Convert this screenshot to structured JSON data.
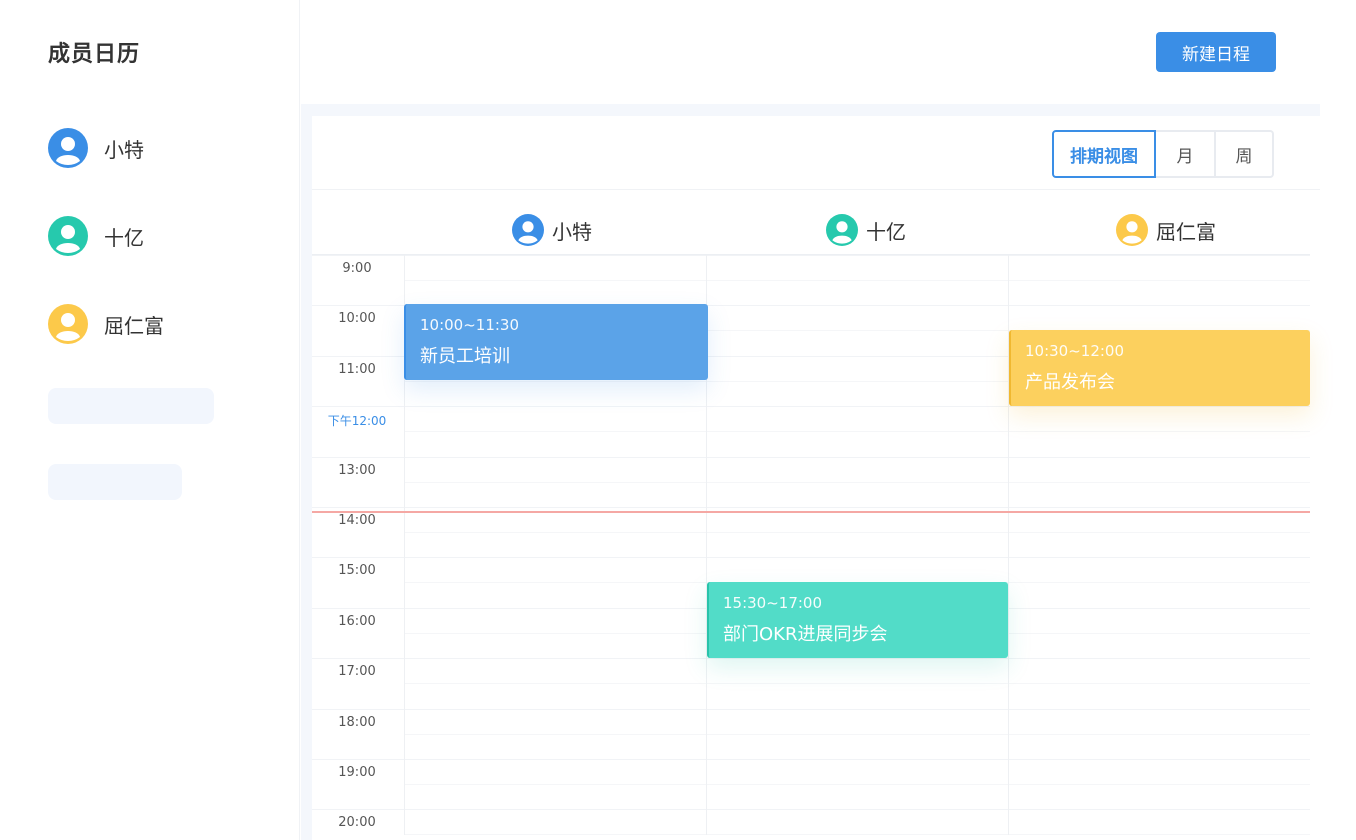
{
  "sidebar": {
    "title": "成员日历",
    "members": [
      {
        "name": "小特",
        "color": "#3a8ee6"
      },
      {
        "name": "十亿",
        "color": "#26c9ad"
      },
      {
        "name": "屈仁富",
        "color": "#fcc94a"
      }
    ]
  },
  "header": {
    "new_button": "新建日程"
  },
  "toolbar": {
    "views": [
      "排期视图",
      "月",
      "周"
    ],
    "active_view": "排期视图"
  },
  "columns": [
    {
      "name": "小特",
      "icon": "user-avatar-icon",
      "color": "#3a8ee6"
    },
    {
      "name": "十亿",
      "icon": "user-avatar-icon",
      "color": "#26c9ad"
    },
    {
      "name": "屈仁富",
      "icon": "user-avatar-icon",
      "color": "#fcc94a"
    }
  ],
  "time_slots": [
    "9:00",
    "10:00",
    "11:00",
    "下午12:00",
    "13:00",
    "14:00",
    "15:00",
    "16:00",
    "17:00",
    "18:00",
    "19:00",
    "20:00"
  ],
  "events": [
    {
      "time": "10:00~11:30",
      "title": "新员工培训",
      "member": "小特",
      "color": "#5ba3e8"
    },
    {
      "time": "10:30~12:00",
      "title": "产品发布会",
      "member": "屈仁富",
      "color": "#fcd05e"
    },
    {
      "time": "15:30~17:00",
      "title": "部门OKR进展同步会",
      "member": "十亿",
      "color": "#52dcc8"
    }
  ]
}
